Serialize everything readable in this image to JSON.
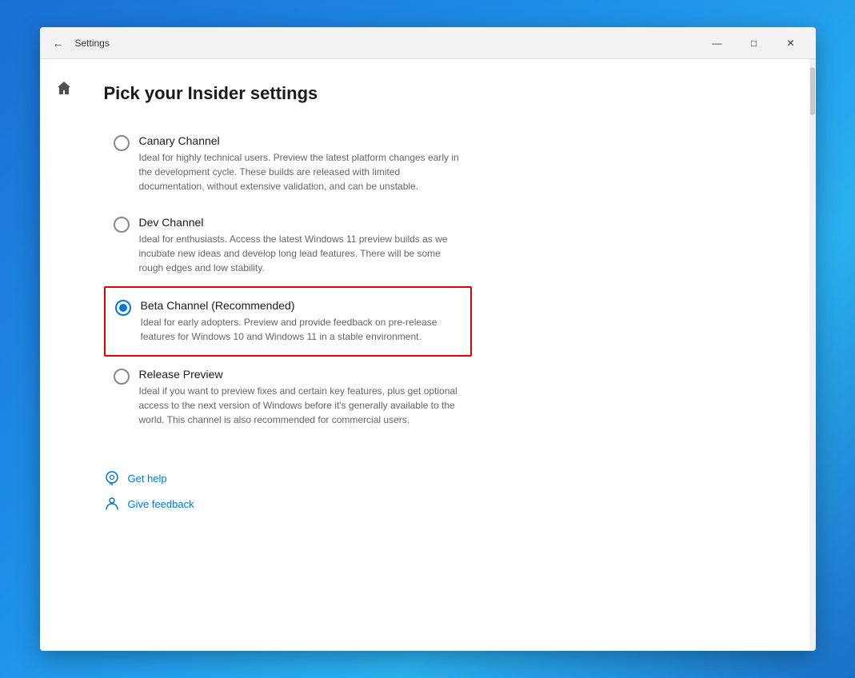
{
  "window": {
    "title": "Settings",
    "back_label": "←",
    "minimize_label": "—",
    "maximize_label": "□",
    "close_label": "✕"
  },
  "page": {
    "title": "Pick your Insider settings"
  },
  "options": [
    {
      "id": "canary",
      "title": "Canary Channel",
      "description": "Ideal for highly technical users. Preview the latest platform changes early in the development cycle. These builds are released with limited documentation, without extensive validation, and can be unstable.",
      "selected": false
    },
    {
      "id": "dev",
      "title": "Dev Channel",
      "description": "Ideal for enthusiasts. Access the latest Windows 11 preview builds as we incubate new ideas and develop long lead features. There will be some rough edges and low stability.",
      "selected": false
    },
    {
      "id": "beta",
      "title": "Beta Channel (Recommended)",
      "description": "Ideal for early adopters. Preview and provide feedback on pre-release features for Windows 10 and Windows 11 in a stable environment.",
      "selected": true
    },
    {
      "id": "release",
      "title": "Release Preview",
      "description": "Ideal if you want to preview fixes and certain key features, plus get optional access to the next version of Windows before it's generally available to the world. This channel is also recommended for commercial users.",
      "selected": false
    }
  ],
  "footer": {
    "get_help_label": "Get help",
    "give_feedback_label": "Give feedback"
  }
}
